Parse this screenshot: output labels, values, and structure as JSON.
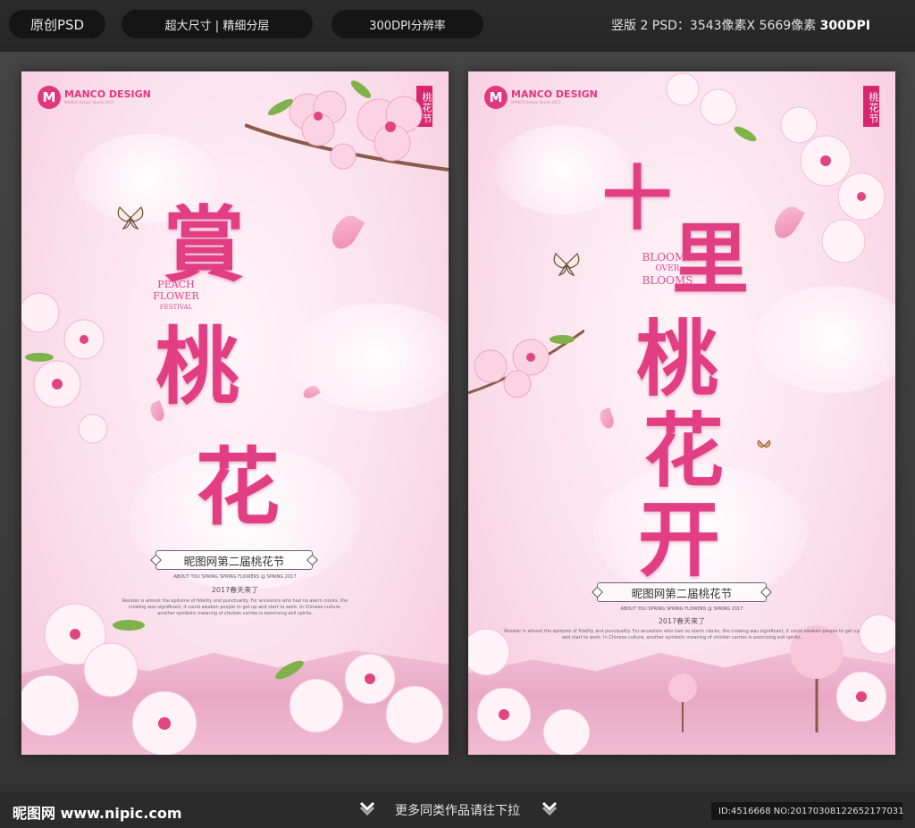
{
  "header": {
    "tags": [
      "原创PSD",
      "超大尺寸 | 精细分层",
      "300DPI分辨率"
    ],
    "spec_prefix": "竖版 2 PSD：3543像素X 5669像素 ",
    "spec_dpi": "300DPI"
  },
  "posters": [
    {
      "logo_mark": "M",
      "logo_text": "MANCO DESIGN",
      "logo_sub": "MANCO Design Studio 2015",
      "seal": "桃花节",
      "title_chars": [
        "賞",
        "桃",
        "花"
      ],
      "english": [
        "PEACH",
        "FLOWER",
        "FESTIVAL"
      ],
      "tagline": "昵图网第二届桃花节",
      "sub_english": "ABOUT YOU SPRING SPRING FLOWERS @ SPRING 2017",
      "date_line": "2017春天来了",
      "paragraph": "Rooster is almost the epitome of fidelity and punctuality. For ancestors who had no alarm clocks, the crowing was significant, it could awaken people to get up and start to work. In Chinese culture, another symbolic meaning of chicken carries is exorcising evil spirits."
    },
    {
      "logo_mark": "M",
      "logo_text": "MANCO DESIGN",
      "logo_sub": "MANCO Design Studio 2015",
      "seal": "桃花节",
      "title_chars": [
        "十",
        "里",
        "桃",
        "花",
        "开"
      ],
      "english": [
        "BLOOMS",
        "OVER",
        "BLOOMS"
      ],
      "tagline": "昵图网第二届桃花节",
      "sub_english": "ABOUT YOU SPRING SPRING FLOWERS @ SPRING 2017",
      "date_line": "2017春天来了",
      "paragraph": "Rooster is almost the epitome of fidelity and punctuality. For ancestors who had no alarm clocks, the crowing was significant, it could awaken people to get up and start to work. In Chinese culture, another symbolic meaning of chicken carries is exorcising evil spirits."
    }
  ],
  "footer": {
    "site": "昵图网 www.nipic.com",
    "more": "更多同类作品请往下拉",
    "id_line": "ID:4516668 NO:20170308122652177031"
  },
  "colors": {
    "accent": "#e23e83",
    "seal": "#d8266e",
    "bar": "#2b2b2b"
  }
}
